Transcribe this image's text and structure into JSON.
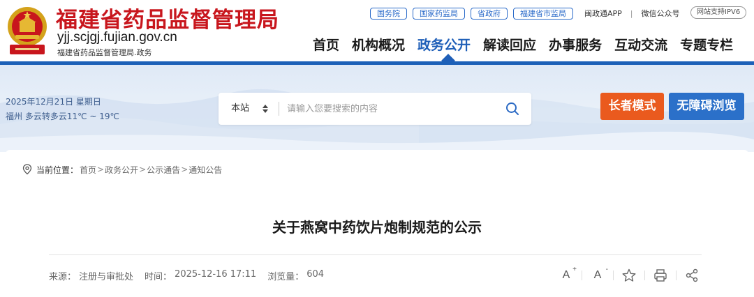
{
  "header": {
    "title": "福建省药品监督管理局",
    "domain": "yjj.scjgj.fujian.gov.cn",
    "subtitle": "福建省药品监督管理局.政务",
    "emblem_icon": "national-emblem-icon"
  },
  "top_links": [
    "国务院",
    "国家药监局",
    "省政府",
    "福建省市监局"
  ],
  "top_texts": {
    "app": "闽政通APP",
    "separator": "|",
    "wechat": "微信公众号",
    "ipv6": "网站支持IPV6"
  },
  "nav": {
    "items": [
      "首页",
      "机构概况",
      "政务公开",
      "解读回应",
      "办事服务",
      "互动交流",
      "专题专栏"
    ],
    "active": "政务公开"
  },
  "info": {
    "date": "2025年12月21日 星期日",
    "weather": "福州 多云转多云11℃ ~ 19℃"
  },
  "search": {
    "scope": "本站",
    "placeholder": "请输入您要搜索的内容",
    "icon": "search-icon"
  },
  "modes": {
    "elder": "长者模式",
    "accessible": "无障碍浏览"
  },
  "breadcrumb": {
    "label": "当前位置：",
    "items": [
      "首页",
      "政务公开",
      "公示通告",
      "通知公告"
    ],
    "separator": ">"
  },
  "article": {
    "title": "关于燕窝中药饮片炮制规范的公示",
    "source_label": "来源：",
    "source": "注册与审批处",
    "time_label": "时间：",
    "time": "2025-12-16 17:11",
    "views_label": "浏览量：",
    "views": "604"
  },
  "tools": {
    "font_up": "A",
    "font_up_sign": "+",
    "font_down": "A",
    "font_down_sign": "-",
    "icons": [
      "font-increase-icon",
      "font-decrease-icon",
      "favorite-star-icon",
      "print-icon",
      "share-icon"
    ]
  },
  "colors": {
    "brand_red": "#c8161d",
    "nav_blue": "#1f5fb8",
    "elder_orange": "#ea5a1e",
    "access_blue": "#2b70c9"
  }
}
